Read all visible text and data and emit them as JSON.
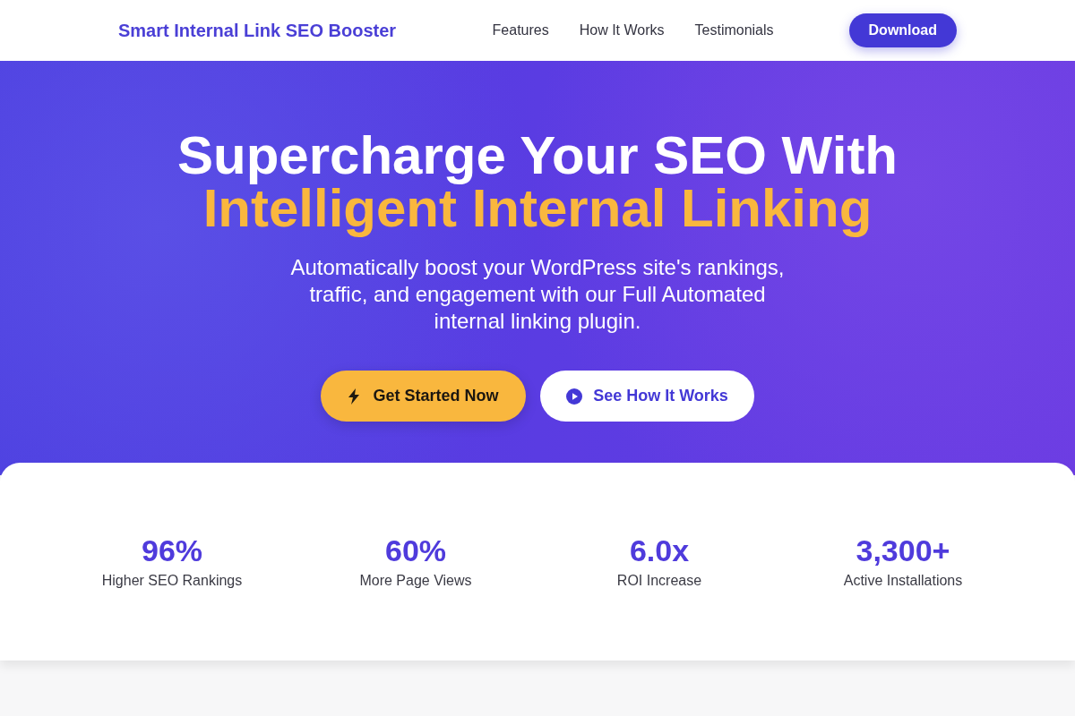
{
  "header": {
    "logo": "Smart Internal Link SEO Booster",
    "nav": [
      "Features",
      "How It Works",
      "Testimonials"
    ],
    "cta": "Download"
  },
  "hero": {
    "headline": "Supercharge Your SEO With",
    "headline_highlight": "Intelligent Internal Linking",
    "subtitle": "Automatically boost your WordPress site's rankings, traffic, and engagement with our Full Automated internal linking plugin.",
    "buttons": [
      {
        "kind": "primary",
        "label": "Get Started Now"
      },
      {
        "kind": "secondary",
        "label": "See How It Works"
      }
    ]
  },
  "stats": [
    {
      "value": "96%",
      "label": "Higher SEO Rankings"
    },
    {
      "value": "60%",
      "label": "More Page Views"
    },
    {
      "value": "6.0x",
      "label": "ROI Increase"
    },
    {
      "value": "3,300+",
      "label": "Active Installations"
    }
  ]
}
